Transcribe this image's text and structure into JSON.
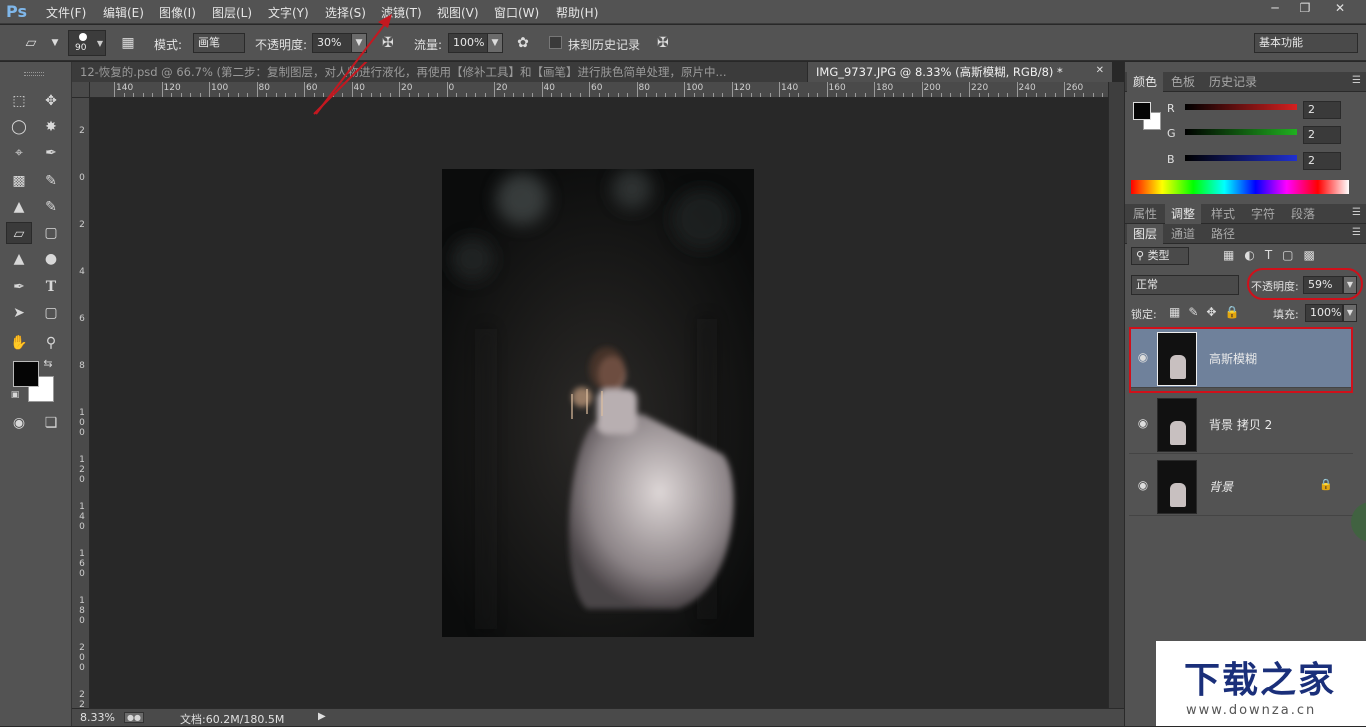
{
  "app": {
    "logo": "Ps"
  },
  "menubar": {
    "items": [
      "文件(F)",
      "编辑(E)",
      "图像(I)",
      "图层(L)",
      "文字(Y)",
      "选择(S)",
      "滤镜(T)",
      "视图(V)",
      "窗口(W)",
      "帮助(H)"
    ],
    "window_controls": [
      "minimize-icon",
      "restore-icon",
      "close-icon"
    ]
  },
  "options": {
    "brush_size": "90",
    "mode_label": "模式:",
    "mode_value": "画笔",
    "opacity_label": "不透明度:",
    "opacity_value": "30%",
    "flow_label": "流量:",
    "flow_value": "100%",
    "history_label": "抹到历史记录",
    "workspace": "基本功能"
  },
  "tabs": [
    {
      "label": "12-恢复的.psd @ 66.7% (第二步：复制图层，对人物进行液化，再使用【修补工具】和【画笔】进行肤色简单处理，原片中...",
      "active": false
    },
    {
      "label": "IMG_9737.JPG @ 8.33% (高斯模糊, RGB/8) *",
      "active": true
    }
  ],
  "ruler_top": [
    "140",
    "120",
    "100",
    "80",
    "60",
    "40",
    "20",
    "0",
    "20",
    "40",
    "60",
    "80",
    "100",
    "120",
    "140",
    "160",
    "180",
    "200",
    "220",
    "240",
    "260"
  ],
  "ruler_left": [
    "2",
    "0",
    "2",
    "4",
    "6",
    "8",
    "1 0 0",
    "1 2 0",
    "1 4 0",
    "1 6 0",
    "1 8 0",
    "2 0 0",
    "2 2 0"
  ],
  "status": {
    "zoom": "8.33%",
    "doc": "文档:60.2M/180.5M"
  },
  "color_panel": {
    "tabs": [
      "颜色",
      "色板",
      "历史记录"
    ],
    "channels": [
      {
        "label": "R",
        "value": "2",
        "color": "#d42020"
      },
      {
        "label": "G",
        "value": "2",
        "color": "#20b020"
      },
      {
        "label": "B",
        "value": "2",
        "color": "#2030d0"
      }
    ]
  },
  "adjust_tabs": [
    "属性",
    "调整",
    "样式",
    "字符",
    "段落"
  ],
  "layers_panel": {
    "tabs": [
      "图层",
      "通道",
      "路径"
    ],
    "filter": "类型",
    "blend_mode": "正常",
    "opacity_label": "不透明度:",
    "opacity_value": "59%",
    "lock_label": "锁定:",
    "fill_label": "填充:",
    "fill_value": "100%",
    "layers": [
      {
        "name": "高斯模糊",
        "selected": true,
        "locked": false
      },
      {
        "name": "背景 拷贝 2",
        "selected": false,
        "locked": false
      },
      {
        "name": "背景",
        "selected": false,
        "locked": true
      }
    ]
  },
  "watermark": {
    "text": "下载之家",
    "url": "www.downza.cn"
  },
  "accent": {
    "highlight_red": "#d0101a",
    "selection_blue": "#6f819b"
  }
}
